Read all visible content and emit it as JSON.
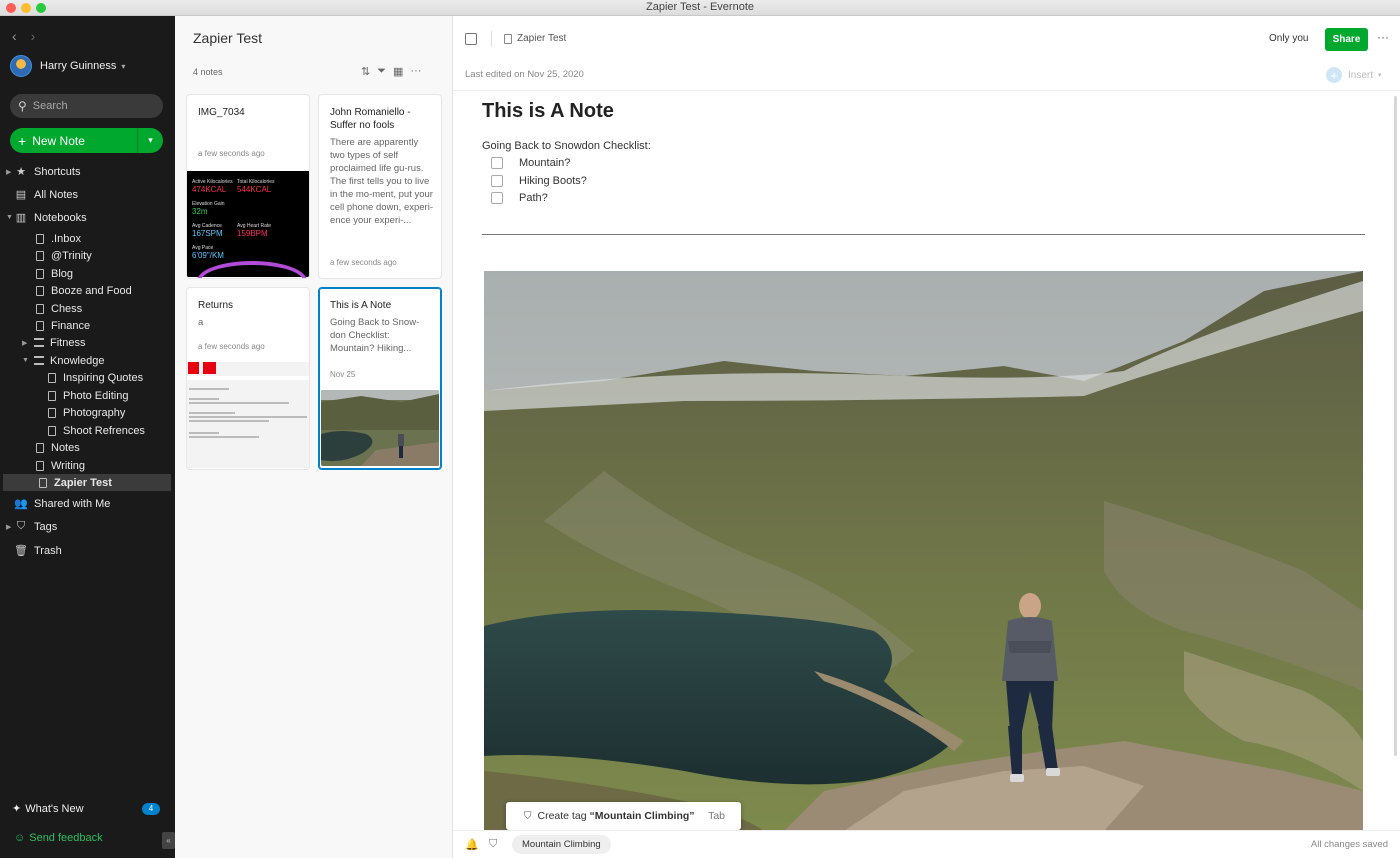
{
  "window": {
    "title": "Zapier Test - Evernote"
  },
  "sidebar": {
    "user_name": "Harry Guinness",
    "search_placeholder": "Search",
    "new_note_label": "New Note",
    "shortcuts": "Shortcuts",
    "all_notes": "All Notes",
    "notebooks": "Notebooks",
    "notebook_items": [
      ".Inbox",
      "@Trinity",
      "Blog",
      "Booze and Food",
      "Chess",
      "Finance",
      "Fitness",
      "Knowledge",
      "Inspiring Quotes",
      "Photo Editing",
      "Photography",
      "Shoot Refrences",
      "Notes",
      "Writing",
      "Zapier Test"
    ],
    "shared_with_me": "Shared with Me",
    "tags": "Tags",
    "trash": "Trash",
    "whats_new": "What's New",
    "whats_new_badge": "4",
    "send_feedback": "Send feedback"
  },
  "notelist": {
    "title": "Zapier Test",
    "count": "4 notes",
    "cards": [
      {
        "title": "IMG_7034",
        "snippet": "",
        "time": "a few seconds ago"
      },
      {
        "title": "John Romaniello - Suffer no fools",
        "snippet": "There are apparently two types of self proclaimed life gu-rus.  The first tells you to live in the mo-ment, put your cell phone down, experi-ence your experi-...",
        "time": "a few seconds ago"
      },
      {
        "title": "Returns",
        "snippet": "a",
        "time": "a few seconds ago"
      },
      {
        "title": "This is A Note",
        "snippet": "Going Back to Snow-don Checklist: Mountain? Hiking...",
        "time": "Nov 25"
      }
    ],
    "fitness_stats": [
      {
        "label": "Active Kilocalories",
        "value": "474KCAL",
        "color": "#ff2d55"
      },
      {
        "label": "Total Kilocalories",
        "value": "544KCAL",
        "color": "#ff2d55"
      },
      {
        "label": "Elevation Gain",
        "value": "32m",
        "color": "#30d158"
      },
      {
        "label": "Avg Cadence",
        "value": "167SPM",
        "color": "#5ac8fa"
      },
      {
        "label": "Avg Heart Rate",
        "value": "159BPM",
        "color": "#ff2d55"
      },
      {
        "label": "Avg Pace",
        "value": "6'09\"/KM",
        "color": "#5ac8fa"
      }
    ]
  },
  "editor": {
    "breadcrumb": "Zapier Test",
    "only_you": "Only you",
    "share_label": "Share",
    "last_edited": "Last edited on Nov 25, 2020",
    "insert_label": "Insert",
    "note_title": "This is A Note",
    "body_heading": "Going Back to Snowdon Checklist:",
    "checklist": [
      "Mountain?",
      "Hiking Boots?",
      "Path?"
    ],
    "tag_popup": {
      "prefix": "Create tag",
      "tag": "“Mountain Climbing”",
      "hint": "Tab"
    },
    "tag_chip": "Mountain Climbing",
    "save_status": "All changes saved"
  },
  "colors": {
    "accent_green": "#00a82d",
    "selection_blue": "#0081cc",
    "sidebar_bg": "#1a1a1a"
  }
}
